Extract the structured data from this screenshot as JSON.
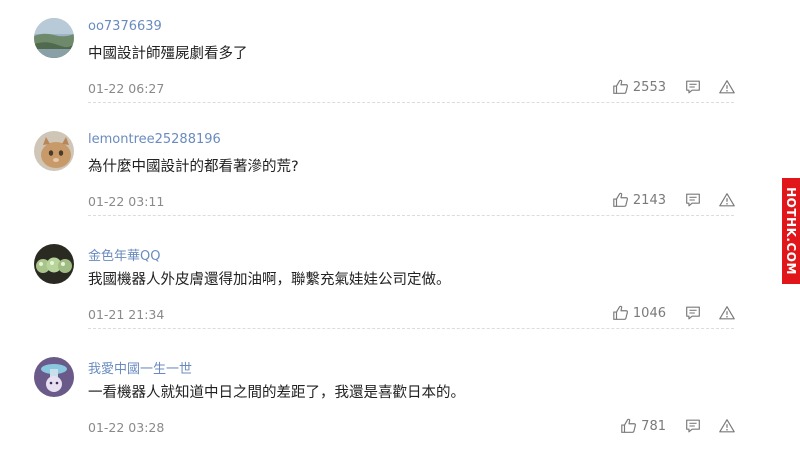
{
  "comments": [
    {
      "username": "oo7376639",
      "text": "中國設計師殭屍劇看多了",
      "time": "01-22 06:27",
      "likes": "2553",
      "avatar": "landscape-avatar"
    },
    {
      "username": "lemontree25288196",
      "text": "為什麼中國設計的都看著滲的荒?",
      "time": "01-22 03:11",
      "likes": "2143",
      "avatar": "cat-avatar"
    },
    {
      "username": "金色年華QQ",
      "text": "我國機器人外皮膚還得加油啊，聯繫充氣娃娃公司定做。",
      "time": "01-21 21:34",
      "likes": "1046",
      "avatar": "spheres-avatar"
    },
    {
      "username": "我愛中國一生一世",
      "text": "一看機器人就知道中日之間的差距了，我還是喜歡日本的。",
      "time": "01-22 03:28",
      "likes": "781",
      "avatar": "cartoon-avatar"
    }
  ],
  "side_tab": {
    "label": "HOTHK.COM"
  },
  "colors": {
    "username": "#6a8bbf",
    "body_text": "#222222",
    "meta_text": "#8a8a8a",
    "icon": "#7a7a7a",
    "side_tab_bg": "#e0161b"
  },
  "icons": {
    "like": "thumbs-up-icon",
    "reply": "comment-icon",
    "report": "warning-icon"
  }
}
